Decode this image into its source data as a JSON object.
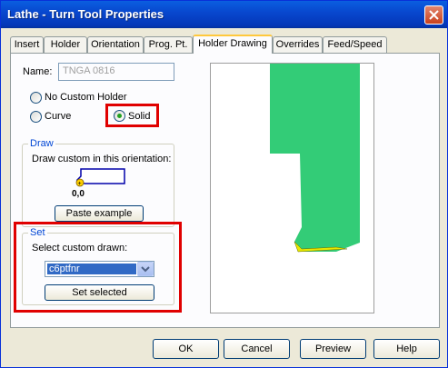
{
  "window": {
    "title": "Lathe - Turn Tool Properties"
  },
  "tabs": [
    {
      "label": "Insert"
    },
    {
      "label": "Holder"
    },
    {
      "label": "Orientation"
    },
    {
      "label": "Prog. Pt."
    },
    {
      "label": "Holder Drawing"
    },
    {
      "label": "Overrides"
    },
    {
      "label": "Feed/Speed"
    }
  ],
  "name": {
    "label": "Name:",
    "value": "TNGA 0816"
  },
  "holder_options": {
    "no_custom": "No Custom Holder",
    "curve": "Curve",
    "solid": "Solid",
    "selected": "Solid"
  },
  "draw_group": {
    "title": "Draw",
    "instruction": "Draw custom in this orientation:",
    "origin_label": "0,0",
    "paste_button": "Paste example"
  },
  "set_group": {
    "title": "Set",
    "select_label": "Select custom drawn:",
    "combo_value": "c6ptfnr",
    "set_button": "Set selected"
  },
  "footer": {
    "ok": "OK",
    "cancel": "Cancel",
    "preview": "Preview",
    "help": "Help"
  },
  "colors": {
    "holder_fill": "#33cc77",
    "insert_fill": "#e8e800",
    "highlight": "#e00000"
  }
}
